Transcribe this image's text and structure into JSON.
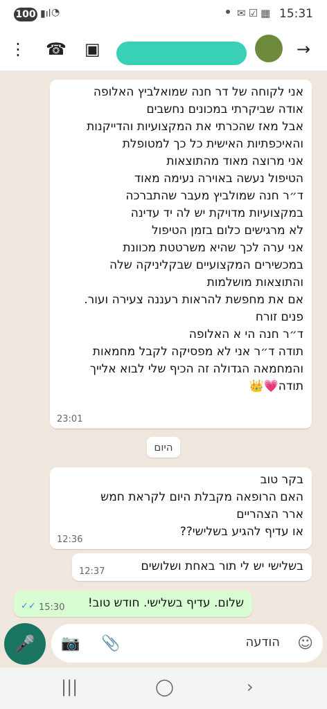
{
  "status": {
    "battery": "100",
    "time": "15:31"
  },
  "header": {
    "back_icon": "arrow-forward",
    "call_icon": "add-call",
    "contact_icon": "contact-card",
    "menu_icon": "more-vert"
  },
  "messages": [
    {
      "text": "אני לקוחה של דר חנה שמואלביץ האלופה\nאודה שביקרתי במכונים נחשבים\nאבל מאז שהכרתי את המקצועיות והדייקנות\nוהאיכפתיות האישית כל כך למטופלת\nאני מרוצה מאוד מהתוצאות\nהטיפול נעשה באוירה נעימה מאוד\nד״ר חנה שמולביץ מעבר שהתברכה\nבמקצועיות מדויקת יש לה יד עדינה\nלא מרגישים כלום בזמן הטיפול\nאני ערה לכך שהיא משרטטת מכוונת\nבמכשירים המקצועיים שבקליניקה שלה\nוהתוצאות מושלמות\nאם את מחפשת להראות רעננה צעירה ועור.\nפנים זורח\nד״ר חנה הי א האלופה\nתודה ד״ר אני לא מפסיקה לקבל מחמאות\nוהמחמאה הגדולה זה הכיף שלי לבוא אלייך\nתודה💗👑",
      "time": "23:01"
    },
    {
      "date": "היום"
    },
    {
      "text": "בקר טוב\nהאם הרופאה מקבלת היום לקראת חמש\nארר הצהריים\nאו עדיף להגיע בשלישי??",
      "time": "12:36"
    },
    {
      "text": "בשלישי יש לי תור באחת ושלושים",
      "time": "12:37"
    },
    {
      "text": "שלום. עדיף בשלישי. חודש טוב!",
      "time": "15:30"
    }
  ],
  "input": {
    "placeholder": "הודעה"
  }
}
